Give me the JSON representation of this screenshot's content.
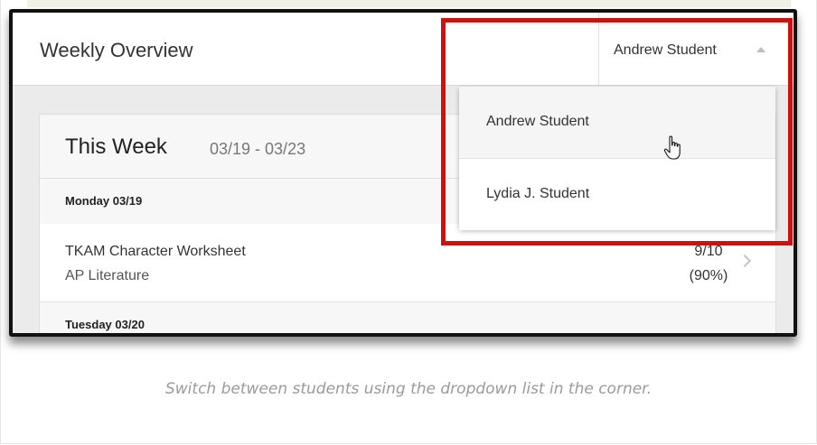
{
  "app": {
    "title": "Weekly Overview",
    "selected_student": "Andrew Student"
  },
  "week": {
    "title": "This Week",
    "range": "03/19 - 03/23",
    "days": [
      {
        "label": "Monday 03/19",
        "assignments": [
          {
            "name": "TKAM Character Worksheet",
            "course": "AP Literature",
            "score": "9/10",
            "percent": "(90%)"
          }
        ]
      },
      {
        "label": "Tuesday 03/20"
      }
    ]
  },
  "dropdown": {
    "options": [
      "Andrew Student",
      "Lydia J. Student"
    ],
    "hovered": "Andrew Student"
  },
  "caption": "Switch between students using the dropdown list in the corner.",
  "colors": {
    "highlight": "#cc1111",
    "frame": "#111111"
  }
}
